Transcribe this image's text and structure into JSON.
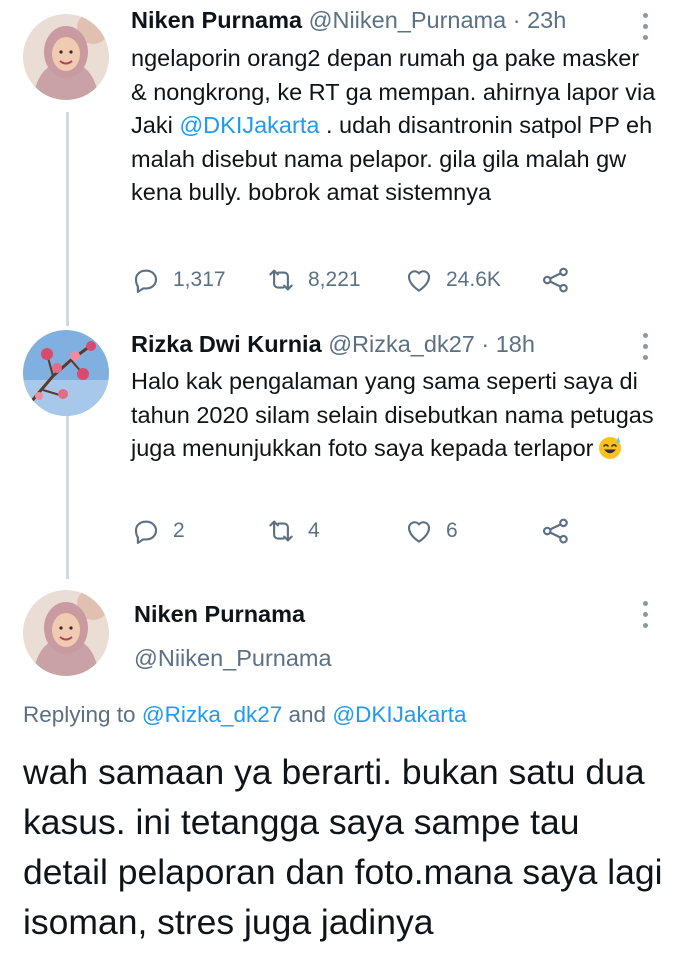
{
  "tweets": [
    {
      "name": "Niken Purnama",
      "handle": "@Niiken_Purnama",
      "time": "· 23h",
      "text_before": "ngelaporin orang2 depan rumah ga pake masker & nongkrong, ke RT ga mempan. ahirnya lapor via Jaki ",
      "mention": "@DKIJakarta",
      "text_after": " . udah disantronin satpol PP eh malah disebut nama pelapor. gila gila malah gw kena bully. bobrok amat sistemnya",
      "replies": "1,317",
      "retweets": "8,221",
      "likes": "24.6K"
    },
    {
      "name": "Rizka Dwi Kurnia",
      "handle": "@Rizka_dk27",
      "time": "· 18h",
      "text": "Halo kak pengalaman yang sama seperti saya di tahun 2020 silam selain disebutkan nama petugas juga menunjukkan foto saya kepada terlapor",
      "emoji": "sweat-smile-emoji",
      "replies": "2",
      "retweets": "4",
      "likes": "6"
    }
  ],
  "main_tweet": {
    "name": "Niken Purnama",
    "handle": "@Niiken_Purnama",
    "replying_prefix": "Replying to",
    "replying_to_1": "@Rizka_dk27",
    "replying_and": "and",
    "replying_to_2": "@DKIJakarta",
    "text": "wah samaan ya berarti. bukan satu dua kasus. ini tetangga saya sampe tau detail pelaporan dan foto.mana saya lagi isoman, stres juga jadinya"
  },
  "icons": {
    "reply": "reply-icon",
    "retweet": "retweet-icon",
    "like": "heart-icon",
    "share": "share-icon",
    "more": "more-vertical-icon"
  },
  "colors": {
    "text": "#0f1419",
    "secondary": "#5b7083",
    "accent": "#1d9bf0",
    "thread_line": "#cfd9de"
  }
}
